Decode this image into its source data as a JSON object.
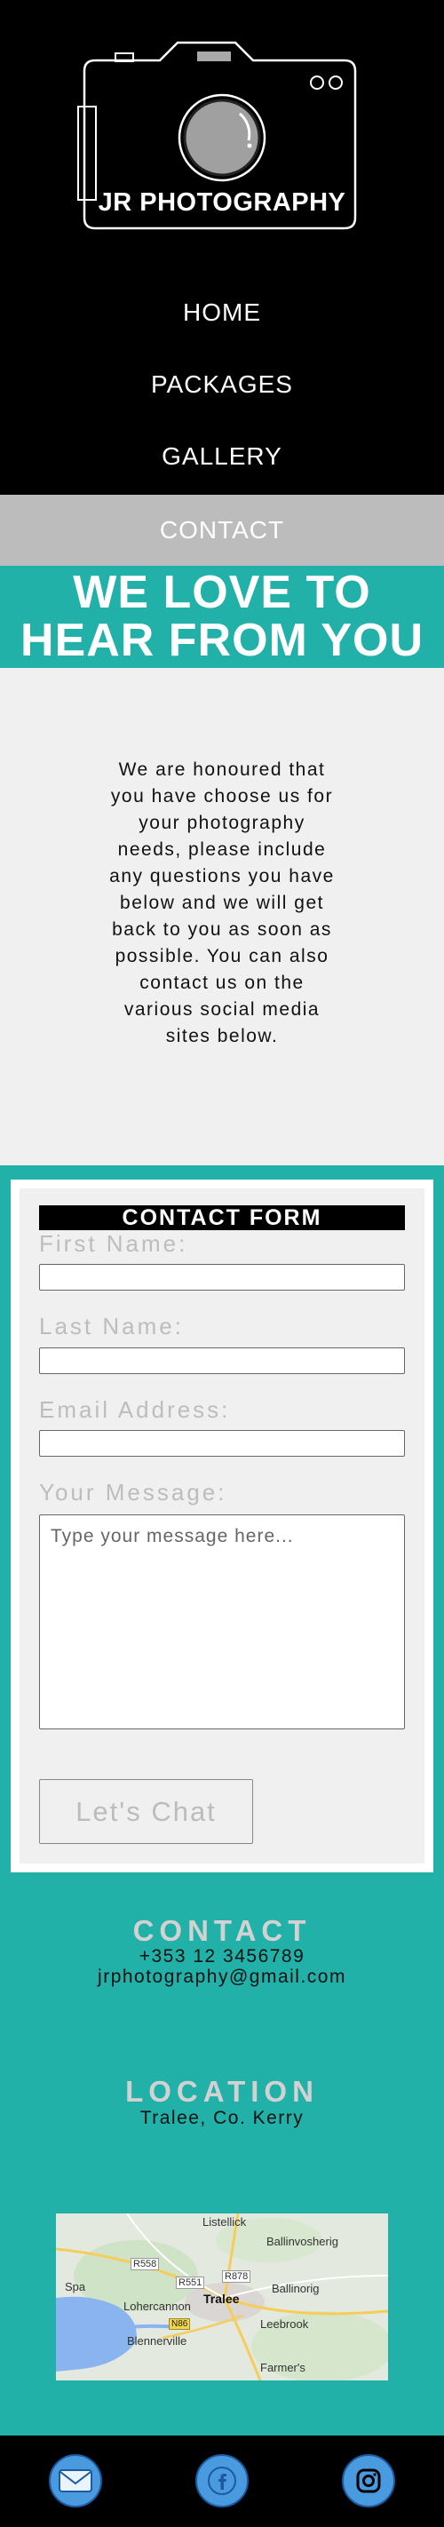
{
  "brand": {
    "name": "JR PHOTOGRAPHY"
  },
  "nav": {
    "items": [
      {
        "label": "HOME"
      },
      {
        "label": "PACKAGES"
      },
      {
        "label": "GALLERY"
      },
      {
        "label": "CONTACT",
        "active": true
      }
    ]
  },
  "hero": {
    "title_line1": "WE LOVE TO",
    "title_line2": "HEAR FROM YOU"
  },
  "intro": {
    "text": "We are honoured that you have choose us for your photography needs, please include any questions you have below and we will get back to you as soon as possible. You can also contact us on the various social media sites below."
  },
  "form": {
    "heading": "CONTACT FORM",
    "first_name_label": "First Name:",
    "last_name_label": "Last Name:",
    "email_label": "Email Address:",
    "message_label": "Your Message:",
    "message_placeholder": "Type your message here...",
    "submit_label": "Let's Chat"
  },
  "contact": {
    "heading": "CONTACT",
    "phone": "+353 12 3456789",
    "email": "jrphotography@gmail.com"
  },
  "location": {
    "heading": "LOCATION",
    "address": "Tralee, Co. Kerry"
  },
  "map": {
    "labels": {
      "listellick": "Listellick",
      "ballinvosherig": "Ballinvosherig",
      "r558": "R558",
      "r878": "R878",
      "spa": "Spa",
      "r551": "R551",
      "ballinorig": "Ballinorig",
      "lohercannon": "Lohercannon",
      "tralee": "Tralee",
      "n86": "N86",
      "leebrook": "Leebrook",
      "blennerville": "Blennerville",
      "farmers": "Farmer's"
    }
  },
  "footer": {
    "icons": [
      "mail-icon",
      "facebook-icon",
      "instagram-icon"
    ]
  },
  "colors": {
    "teal": "#21b1a8",
    "black": "#000000",
    "light_gray": "#f0f0f0",
    "active_nav": "#bcbcbc",
    "social_blue": "#4a9ae0"
  }
}
